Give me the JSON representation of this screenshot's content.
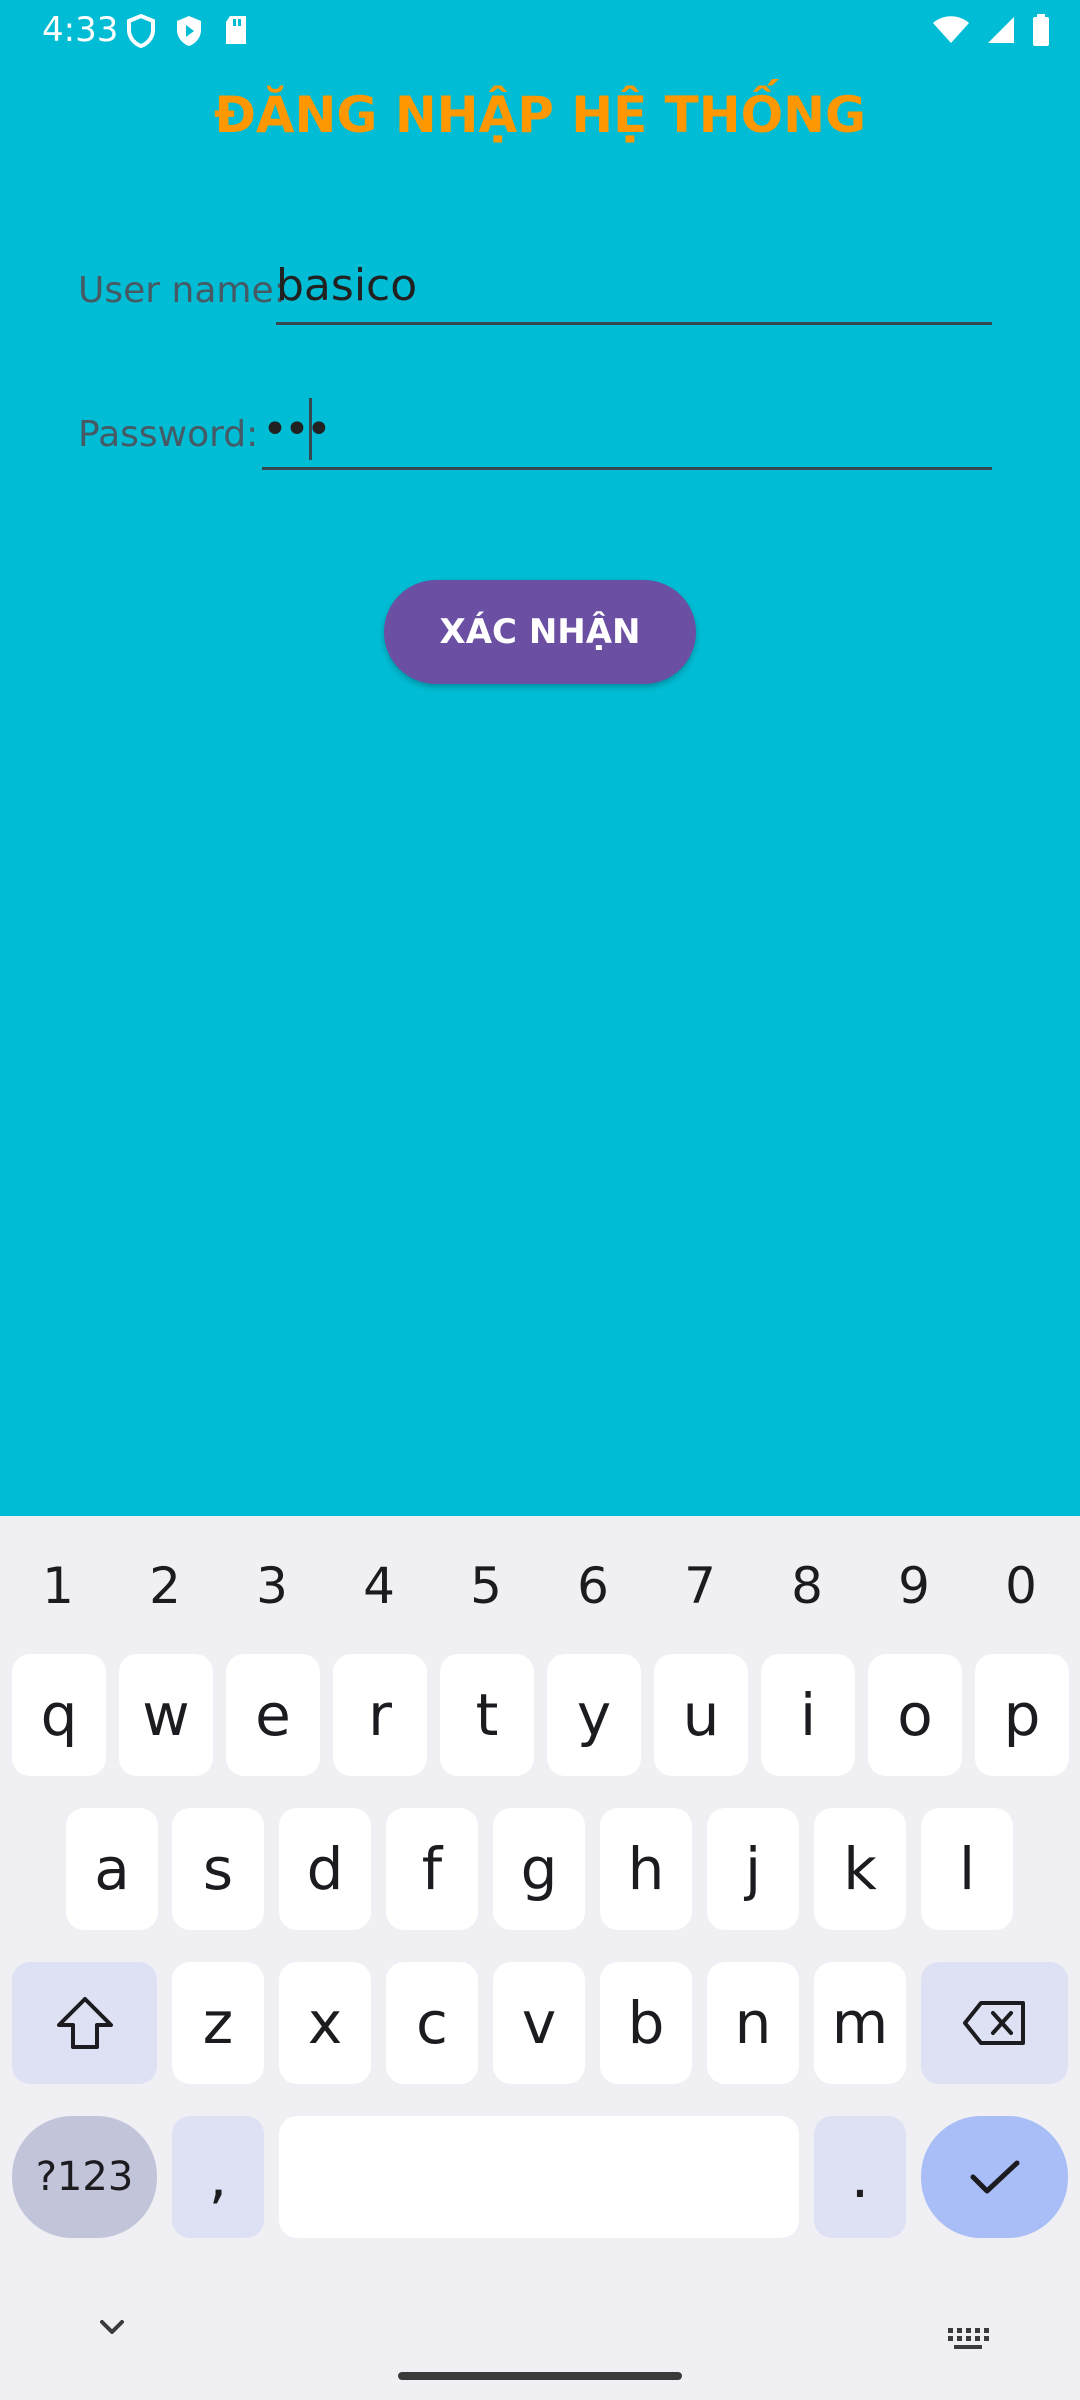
{
  "status_bar": {
    "time": "4:33",
    "left_icons": [
      "shield-icon",
      "play-protect-icon",
      "sd-card-icon"
    ],
    "right_icons": [
      "wifi-icon",
      "signal-icon",
      "battery-icon"
    ]
  },
  "app": {
    "title": "ĐĂNG NHẬP HỆ THỐNG",
    "username_label": "User name:",
    "username_value": "basico",
    "password_label": "Password:",
    "password_value": "•••",
    "confirm_label": "XÁC NHẬN"
  },
  "colors": {
    "background": "#00BCD4",
    "title": "#FF9800",
    "button": "#6A4FA3",
    "keyboard_bg": "#EFEFF4"
  },
  "keyboard": {
    "number_row": [
      "1",
      "2",
      "3",
      "4",
      "5",
      "6",
      "7",
      "8",
      "9",
      "0"
    ],
    "row1": [
      "q",
      "w",
      "e",
      "r",
      "t",
      "y",
      "u",
      "i",
      "o",
      "p"
    ],
    "row2": [
      "a",
      "s",
      "d",
      "f",
      "g",
      "h",
      "j",
      "k",
      "l"
    ],
    "row3": [
      "z",
      "x",
      "c",
      "v",
      "b",
      "n",
      "m"
    ],
    "symbols_label": "?123",
    "comma": ",",
    "period": ".",
    "shift_icon": "shift-icon",
    "backspace_icon": "backspace-icon",
    "enter_icon": "checkmark-icon"
  },
  "nav": {
    "hide_keyboard_icon": "chevron-down-icon",
    "switch_keyboard_icon": "keyboard-icon"
  }
}
